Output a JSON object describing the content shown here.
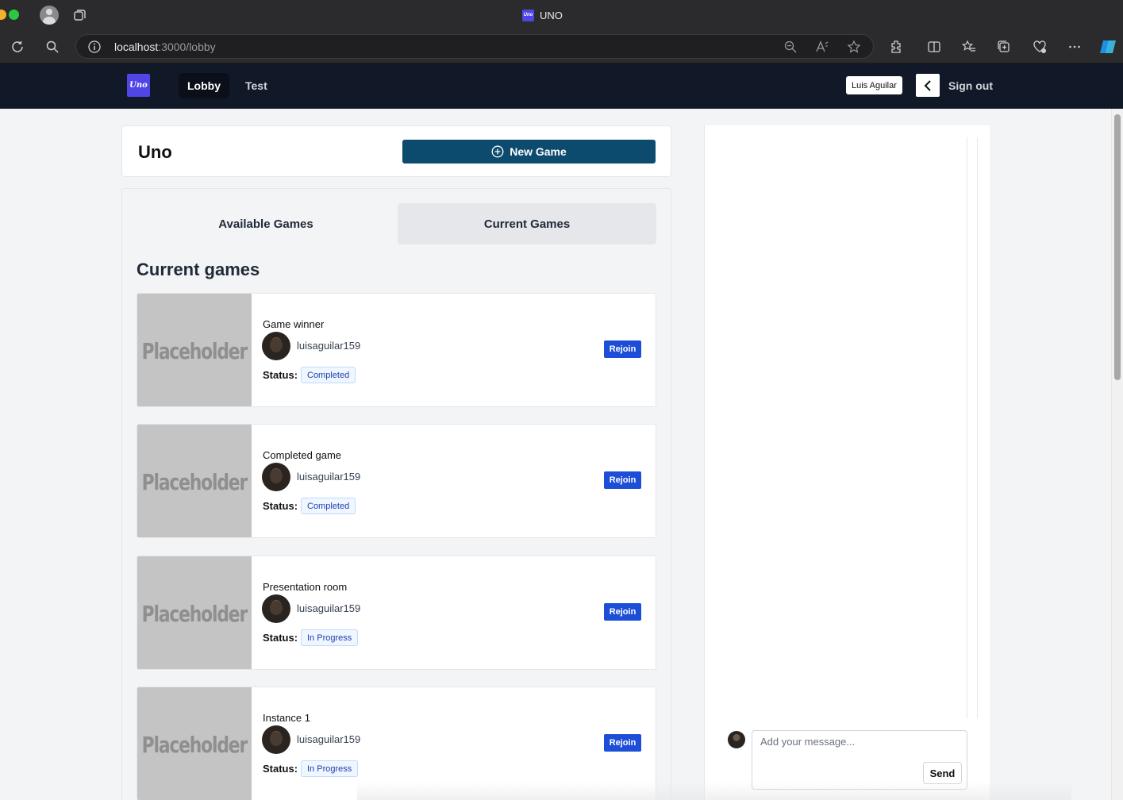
{
  "browser": {
    "window_title": "UNO",
    "favicon_text": "Uno",
    "url_host": "localhost",
    "url_path": ":3000/lobby"
  },
  "nav": {
    "logo_text": "Uno",
    "links": [
      "Lobby",
      "Test"
    ],
    "user_name": "Luis Aguilar",
    "sign_out": "Sign out"
  },
  "header": {
    "title": "Uno",
    "new_game_label": "New Game"
  },
  "tabs": {
    "available": "Available Games",
    "current": "Current Games",
    "selected": "Current Games"
  },
  "section_title": "Current games",
  "games": [
    {
      "name": "Game winner",
      "user": "luisaguilar159",
      "status_label": "Status:",
      "status": "Completed",
      "button": "Rejoin",
      "image_text": "Placeholder"
    },
    {
      "name": "Completed game",
      "user": "luisaguilar159",
      "status_label": "Status:",
      "status": "Completed",
      "button": "Rejoin",
      "image_text": "Placeholder"
    },
    {
      "name": "Presentation room",
      "user": "luisaguilar159",
      "status_label": "Status:",
      "status": "In Progress",
      "button": "Rejoin",
      "image_text": "Placeholder"
    },
    {
      "name": "Instance 1",
      "user": "luisaguilar159",
      "status_label": "Status:",
      "status": "In Progress",
      "button": "Rejoin",
      "image_text": "Placeholder"
    }
  ],
  "chat": {
    "placeholder": "Add your message...",
    "send_label": "Send"
  },
  "colors": {
    "nav_bg": "#111827",
    "new_game_bg": "#0c4a6e",
    "rejoin_bg": "#1d4ed8",
    "logo_bg": "#4f46e5"
  }
}
